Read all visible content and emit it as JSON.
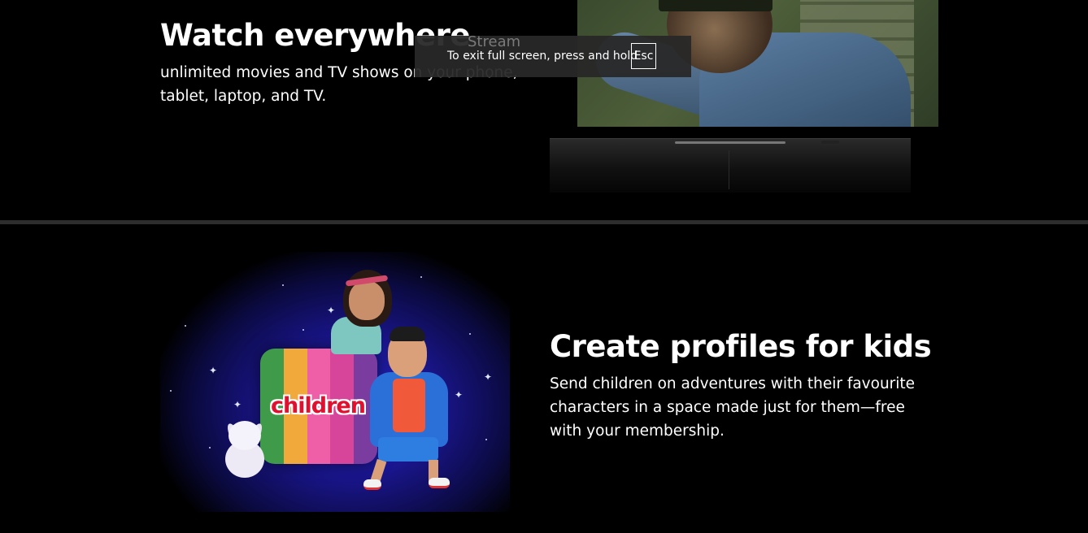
{
  "colors": {
    "background": "#000000",
    "separator": "#2d2d2d",
    "overlay": "#282828",
    "logo_red": "#e0102f",
    "text": "#ffffff"
  },
  "section_watch": {
    "title": "Watch everywhere",
    "description": "unlimited movies and TV shows on your phone, tablet, laptop, and TV."
  },
  "fullscreen_notice": {
    "ghost_label": "Stream",
    "text": "To exit full screen, press and hold",
    "key": "Esc"
  },
  "section_kids": {
    "title": "Create profiles for kids",
    "description": "Send children on adventures with their favourite characters in a space made just for them—free with your membership.",
    "logo_text": "children",
    "tile_colors": [
      "#3f9b4a",
      "#f2a93b",
      "#ef5fa8",
      "#d6459a",
      "#7b3ca0"
    ]
  },
  "icons": {
    "tv": "tv-device-icon",
    "kids_illustration": "kids-characters-illustration"
  }
}
